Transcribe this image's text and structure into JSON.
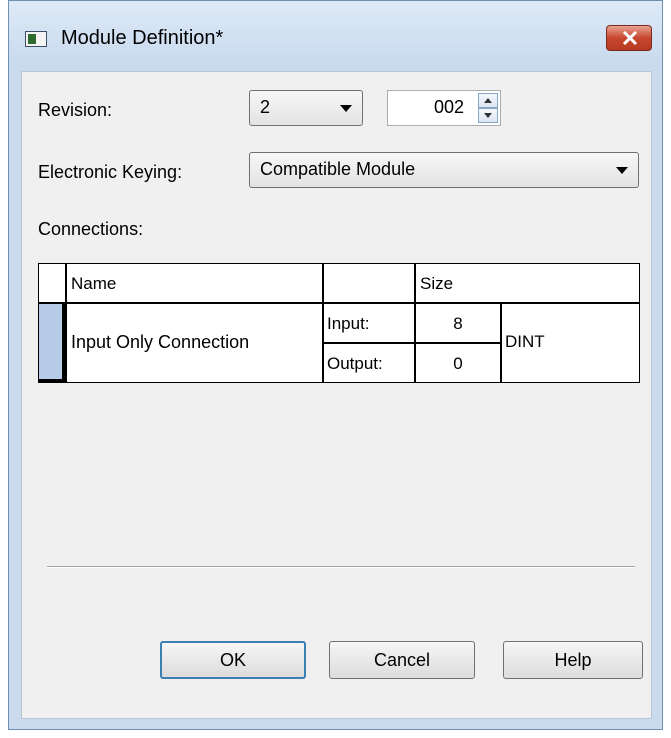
{
  "window": {
    "title": "Module Definition*"
  },
  "revision": {
    "label": "Revision:",
    "major": "2",
    "minor": "002"
  },
  "keying": {
    "label": "Electronic Keying:",
    "value": "Compatible Module"
  },
  "connections": {
    "label": "Connections:",
    "headers": {
      "name": "Name",
      "type": "",
      "size": "Size"
    },
    "row": {
      "name": "Input Only Connection",
      "input_label": "Input:",
      "input_size": "8",
      "output_label": "Output:",
      "output_size": "0",
      "data_type": "DINT"
    }
  },
  "buttons": {
    "ok": "OK",
    "cancel": "Cancel",
    "help": "Help"
  },
  "icons": {
    "app": "module-window-icon",
    "close": "close-icon",
    "dropdown": "chevron-down-icon",
    "spin_up": "spin-up-icon",
    "spin_down": "spin-down-icon"
  }
}
